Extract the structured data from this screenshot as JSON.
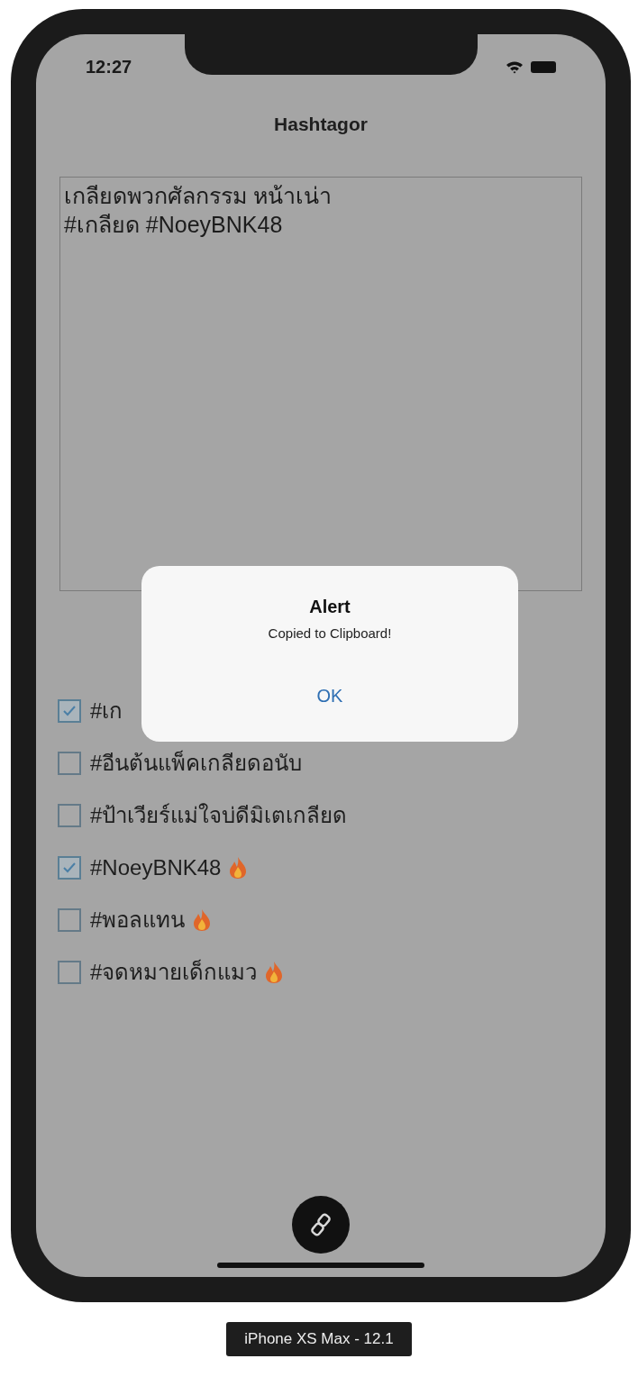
{
  "status_bar": {
    "time": "12:27"
  },
  "nav": {
    "title": "Hashtagor"
  },
  "text_area": {
    "value": "เกลียดพวกศัลกรรม หน้าเน่า\n#เกลียด #NoeyBNK48"
  },
  "hashtags": [
    {
      "label": "#เก",
      "checked": true,
      "flame": false
    },
    {
      "label": "#อีนต้นแพ็คเกลียดอนับ",
      "checked": false,
      "flame": false
    },
    {
      "label": "#ป้าเวียร์แม่ใจบ่ดีมิเตเกลียด",
      "checked": false,
      "flame": false
    },
    {
      "label": "#NoeyBNK48",
      "checked": true,
      "flame": true
    },
    {
      "label": "#พอลแทน",
      "checked": false,
      "flame": true
    },
    {
      "label": "#จดหมายเด็กแมว",
      "checked": false,
      "flame": true
    }
  ],
  "alert": {
    "title": "Alert",
    "message": "Copied to Clipboard!",
    "button": "OK"
  },
  "device_label": "iPhone XS Max - 12.1"
}
